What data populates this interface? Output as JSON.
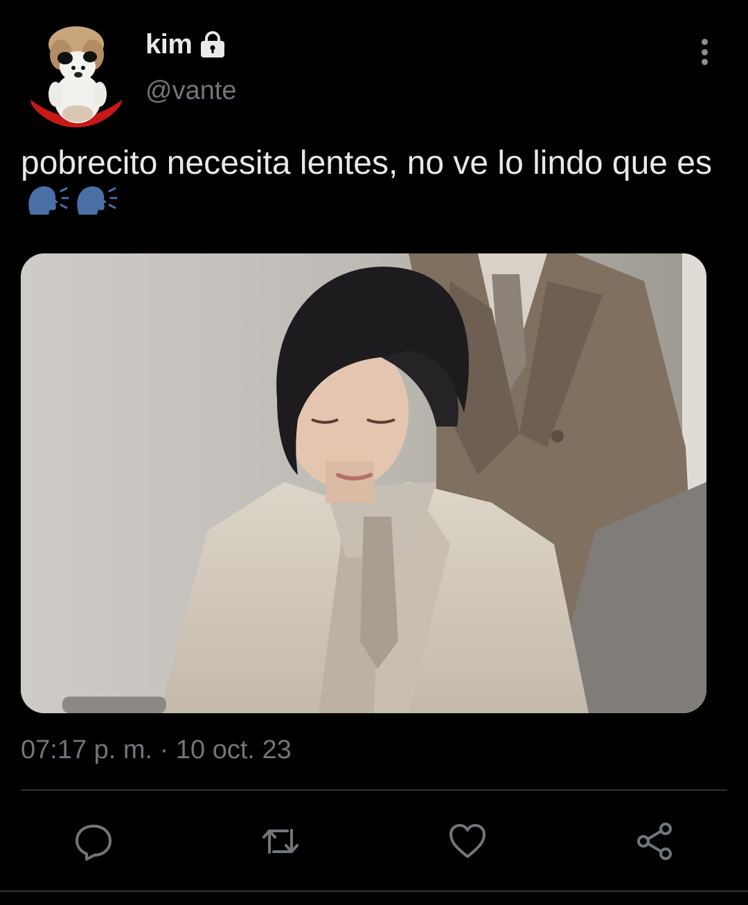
{
  "user": {
    "display_name": "kim",
    "handle": "@vante",
    "protected_icon": "lock-icon",
    "avatar": "plush-bear-avatar"
  },
  "tweet": {
    "text": "pobrecito necesita lentes, no ve lo lindo que es",
    "emoji": [
      "speaking-head-emoji",
      "speaking-head-emoji"
    ],
    "timestamp": "07:17 p. m. · 10 oct. 23",
    "media": "photo-person-in-beige-suit"
  },
  "actions": {
    "reply_icon": "reply-icon",
    "retweet_icon": "retweet-icon",
    "like_icon": "heart-icon",
    "share_icon": "share-icon"
  },
  "colors": {
    "background": "#000000",
    "text": "#e7e9ea",
    "secondary_text": "#71767b",
    "divider": "#2f3336",
    "action_icon": "#71767b"
  }
}
